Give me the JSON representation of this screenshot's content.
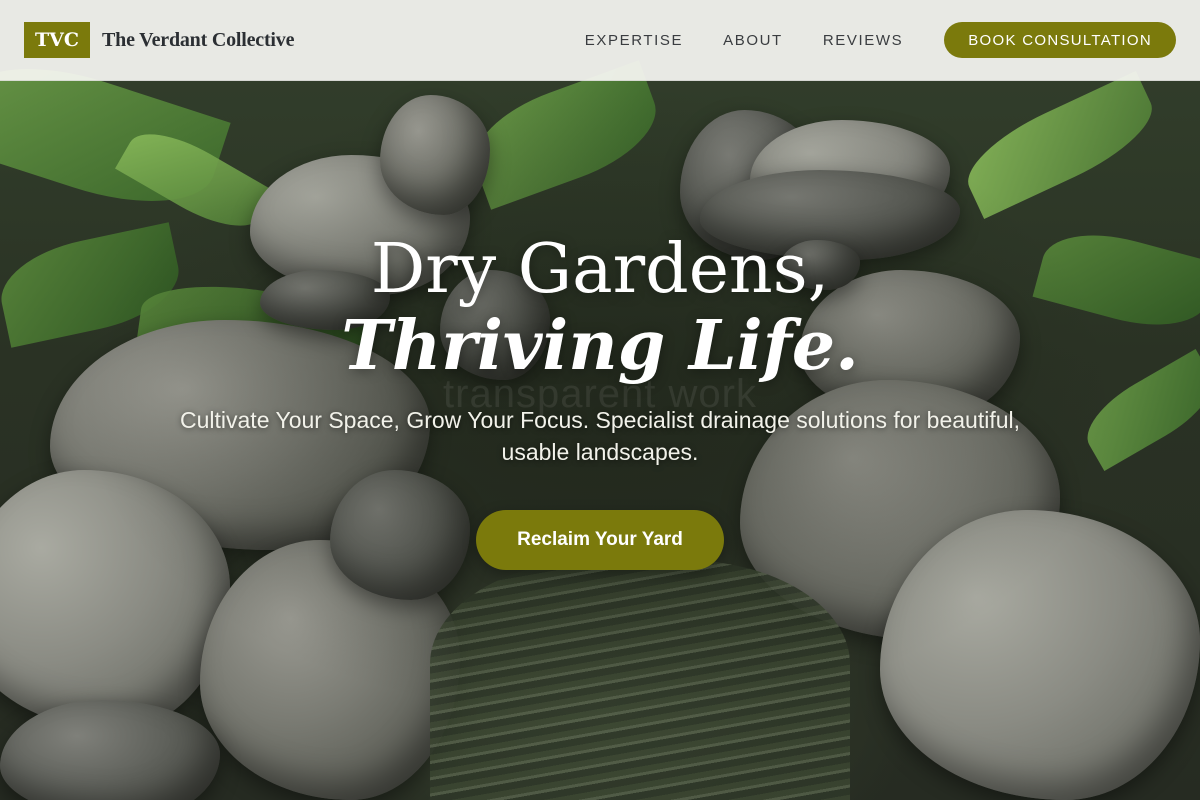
{
  "header": {
    "logo_text": "TVC",
    "brand_name": "The Verdant Collective",
    "nav": [
      {
        "label": "EXPERTISE"
      },
      {
        "label": "ABOUT"
      },
      {
        "label": "REVIEWS"
      }
    ],
    "book_label": "BOOK CONSULTATION"
  },
  "hero": {
    "headline_line1": "Dry Gardens,",
    "headline_line2": "Thriving Life.",
    "subtext": "Cultivate Your Space, Grow Your Focus. Specialist drainage solutions for beautiful, usable landscapes.",
    "cta_label": "Reclaim Your Yard",
    "watermark": "transparent work"
  },
  "colors": {
    "accent": "#7b7a0c",
    "header_bg": "#f6f6f2",
    "text_dark": "#2b2f33"
  },
  "icons": [
    "logo-badge"
  ]
}
